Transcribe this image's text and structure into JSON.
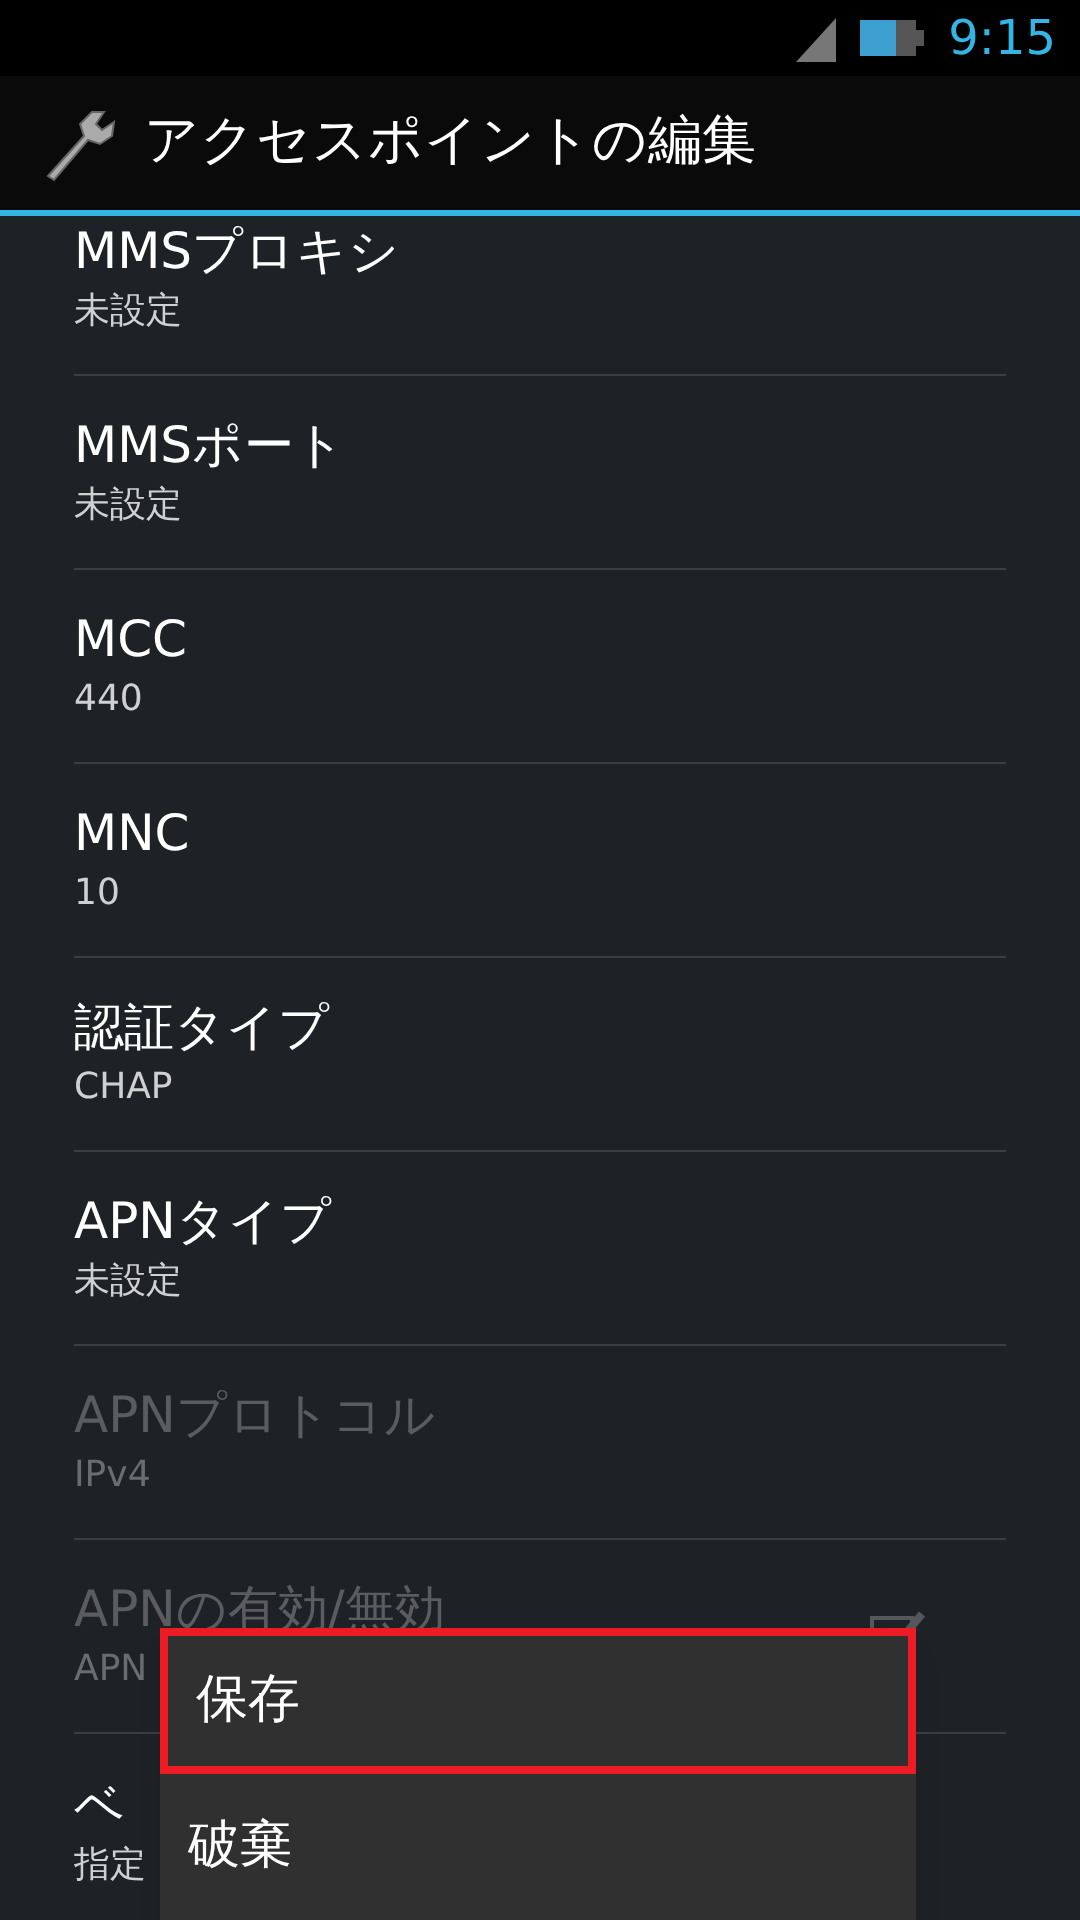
{
  "status_bar": {
    "time": "9:15"
  },
  "action_bar": {
    "title": "アクセスポイントの編集"
  },
  "settings": [
    {
      "kind": "text",
      "title": "MMSプロキシ",
      "summary": "未設定",
      "disabled": false
    },
    {
      "kind": "text",
      "title": "MMSポート",
      "summary": "未設定",
      "disabled": false
    },
    {
      "kind": "text",
      "title": "MCC",
      "summary": "440",
      "disabled": false
    },
    {
      "kind": "text",
      "title": "MNC",
      "summary": "10",
      "disabled": false
    },
    {
      "kind": "text",
      "title": "認証タイプ",
      "summary": "CHAP",
      "disabled": false
    },
    {
      "kind": "text",
      "title": "APNタイプ",
      "summary": "未設定",
      "disabled": false
    },
    {
      "kind": "text",
      "title": "APNプロトコル",
      "summary": "IPv4",
      "disabled": true
    },
    {
      "kind": "checkbox",
      "title": "APNの有効/無効",
      "summary": "APN",
      "disabled": true,
      "checked": true
    },
    {
      "kind": "text",
      "title": "ベ",
      "summary": "指定",
      "disabled": false
    }
  ],
  "menu": [
    {
      "label": "保存",
      "selected": true
    },
    {
      "label": "破棄",
      "selected": false
    }
  ]
}
